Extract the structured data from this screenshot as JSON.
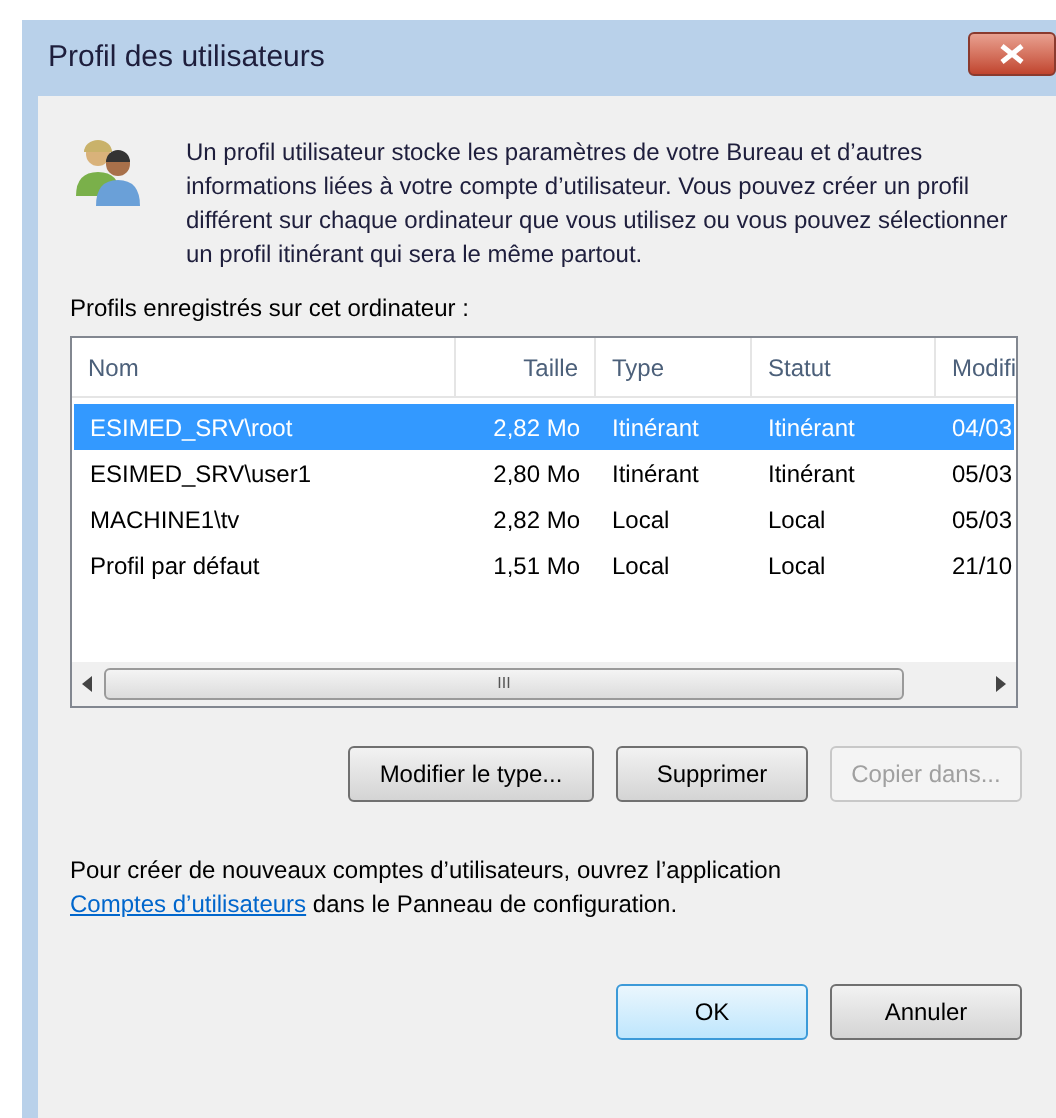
{
  "window": {
    "title": "Profil des utilisateurs"
  },
  "intro": "Un profil utilisateur stocke les paramètres de votre Bureau et d’autres informations liées à votre compte d’utilisateur. Vous pouvez créer un profil différent sur chaque ordinateur que vous utilisez ou vous pouvez sélectionner un profil itinérant qui sera le même partout.",
  "table": {
    "label": "Profils enregistrés sur cet ordinateur :",
    "columns": [
      "Nom",
      "Taille",
      "Type",
      "Statut",
      "Modifi"
    ],
    "rows": [
      {
        "cells": [
          "ESIMED_SRV\\root",
          "2,82 Mo",
          "Itinérant",
          "Itinérant",
          "04/03"
        ],
        "selected": true
      },
      {
        "cells": [
          "ESIMED_SRV\\user1",
          "2,80 Mo",
          "Itinérant",
          "Itinérant",
          "05/03"
        ],
        "selected": false
      },
      {
        "cells": [
          "MACHINE1\\tv",
          "2,82 Mo",
          "Local",
          "Local",
          "05/03"
        ],
        "selected": false
      },
      {
        "cells": [
          "Profil par défaut",
          "1,51 Mo",
          "Local",
          "Local",
          "21/10"
        ],
        "selected": false
      }
    ],
    "scrollbar_grip": "III"
  },
  "actions": [
    {
      "label": "Modifier le type...",
      "disabled": false
    },
    {
      "label": "Supprimer",
      "disabled": false
    },
    {
      "label": "Copier dans...",
      "disabled": true
    }
  ],
  "footer": {
    "text": "Pour créer de nouveaux comptes d’utilisateurs, ouvrez l’application",
    "link": "Comptes d’utilisateurs",
    "after": "dans le Panneau de configuration."
  },
  "buttons": [
    {
      "label": "OK",
      "default": true
    },
    {
      "label": "Annuler",
      "default": false
    }
  ]
}
